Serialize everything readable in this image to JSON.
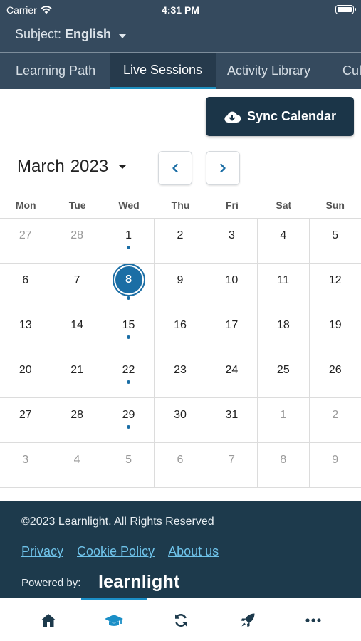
{
  "status_bar": {
    "carrier": "Carrier",
    "time": "4:31 PM"
  },
  "subject": {
    "label": "Subject:",
    "value": "English"
  },
  "tabs": [
    {
      "label": "Learning Path",
      "active": false
    },
    {
      "label": "Live Sessions",
      "active": true
    },
    {
      "label": "Activity Library",
      "active": false
    },
    {
      "label": "Cul",
      "active": false
    }
  ],
  "sync_button": {
    "label": "Sync Calendar",
    "icon": "cloud-download-icon"
  },
  "calendar": {
    "month": "March",
    "year": "2023",
    "weekdays": [
      "Mon",
      "Tue",
      "Wed",
      "Thu",
      "Fri",
      "Sat",
      "Sun"
    ],
    "weeks": [
      [
        {
          "day": "27",
          "muted": true
        },
        {
          "day": "28",
          "muted": true
        },
        {
          "day": "1",
          "session": true
        },
        {
          "day": "2"
        },
        {
          "day": "3"
        },
        {
          "day": "4"
        },
        {
          "day": "5"
        }
      ],
      [
        {
          "day": "6"
        },
        {
          "day": "7"
        },
        {
          "day": "8",
          "session": true,
          "today": true
        },
        {
          "day": "9"
        },
        {
          "day": "10"
        },
        {
          "day": "11"
        },
        {
          "day": "12"
        }
      ],
      [
        {
          "day": "13"
        },
        {
          "day": "14"
        },
        {
          "day": "15",
          "session": true
        },
        {
          "day": "16"
        },
        {
          "day": "17"
        },
        {
          "day": "18"
        },
        {
          "day": "19"
        }
      ],
      [
        {
          "day": "20"
        },
        {
          "day": "21"
        },
        {
          "day": "22",
          "session": true
        },
        {
          "day": "23"
        },
        {
          "day": "24"
        },
        {
          "day": "25"
        },
        {
          "day": "26"
        }
      ],
      [
        {
          "day": "27"
        },
        {
          "day": "28"
        },
        {
          "day": "29",
          "session": true
        },
        {
          "day": "30"
        },
        {
          "day": "31"
        },
        {
          "day": "1",
          "muted": true
        },
        {
          "day": "2",
          "muted": true
        }
      ],
      [
        {
          "day": "3",
          "muted": true
        },
        {
          "day": "4",
          "muted": true
        },
        {
          "day": "5",
          "muted": true
        },
        {
          "day": "6",
          "muted": true
        },
        {
          "day": "7",
          "muted": true
        },
        {
          "day": "8",
          "muted": true
        },
        {
          "day": "9",
          "muted": true
        }
      ]
    ]
  },
  "footer": {
    "copyright": "©2023 Learnlight. All Rights Reserved",
    "links": [
      "Privacy",
      "Cookie Policy",
      "About us"
    ],
    "powered_by": "Powered by:",
    "brand": "learnlight"
  },
  "bottom_nav": [
    {
      "icon": "home-icon",
      "active": false
    },
    {
      "icon": "graduation-cap-icon",
      "active": true
    },
    {
      "icon": "sync-icon",
      "active": false
    },
    {
      "icon": "rocket-icon",
      "active": false
    },
    {
      "icon": "more-icon",
      "active": false
    }
  ],
  "colors": {
    "header_bg": "#354a5e",
    "active_tab_bg": "#263a4c",
    "accent": "#1b6ea5",
    "footer_bg": "#1d3a4c",
    "link": "#6fc3ea"
  }
}
